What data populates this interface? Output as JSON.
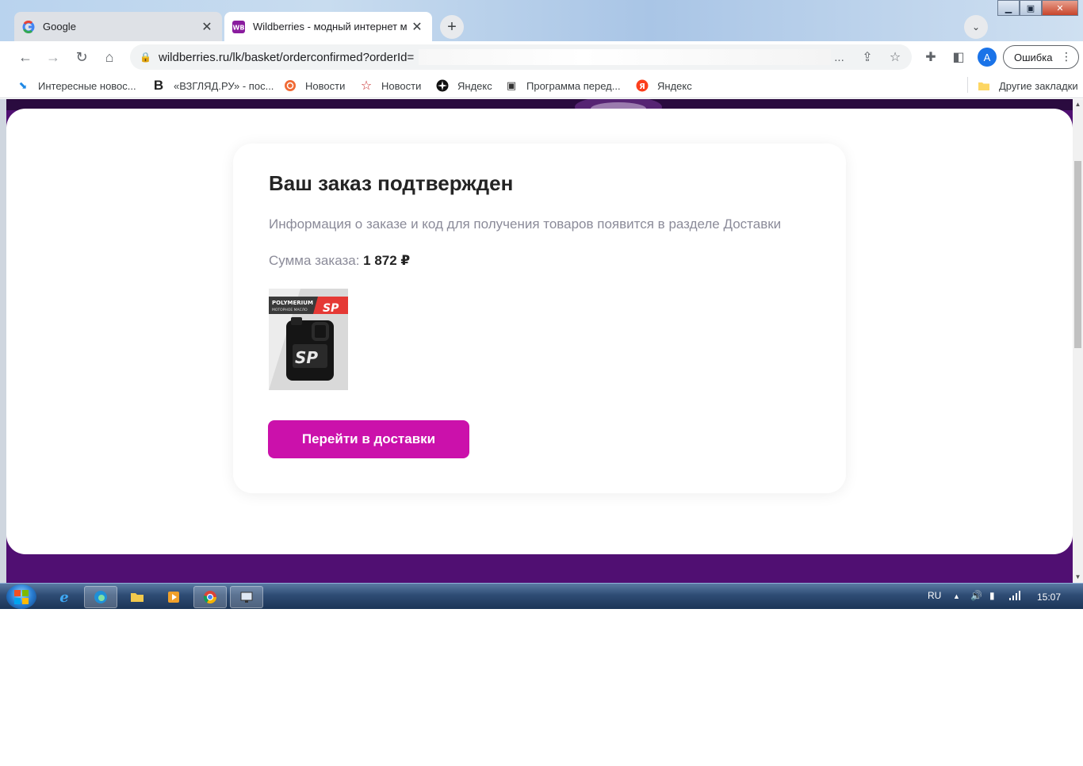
{
  "browser": {
    "tabs": [
      {
        "title": "Google",
        "active": false
      },
      {
        "title": "Wildberries - модный интернет м",
        "active": true
      }
    ],
    "url": "wildberries.ru/lk/basket/orderconfirmed?orderId=",
    "url_ellipsis": "...",
    "profile_initial": "A",
    "error_button": "Ошибка",
    "bookmarks": [
      "Интересные новос...",
      "«ВЗГЛЯД.РУ» - пос...",
      "Новости",
      "Новости",
      "Яндекс",
      "Программа перед...",
      "Яндекс"
    ],
    "other_bookmarks": "Другие закладки"
  },
  "page": {
    "title": "Ваш заказ подтвержден",
    "info": "Информация о заказе и код для получения товаров появится в разделе Доставки",
    "sum_label": "Сумма заказа:",
    "sum_value": "1 872 ₽",
    "product_brand": "POLYMERIUM",
    "product_sub": "МОТОРНОЕ МАСЛО",
    "product_logo": "SP",
    "button_label": "Перейти в доставки"
  },
  "taskbar": {
    "language": "RU",
    "time": "15:07"
  },
  "colors": {
    "brand": "#cb11ab",
    "page_bg": "#500f72"
  }
}
